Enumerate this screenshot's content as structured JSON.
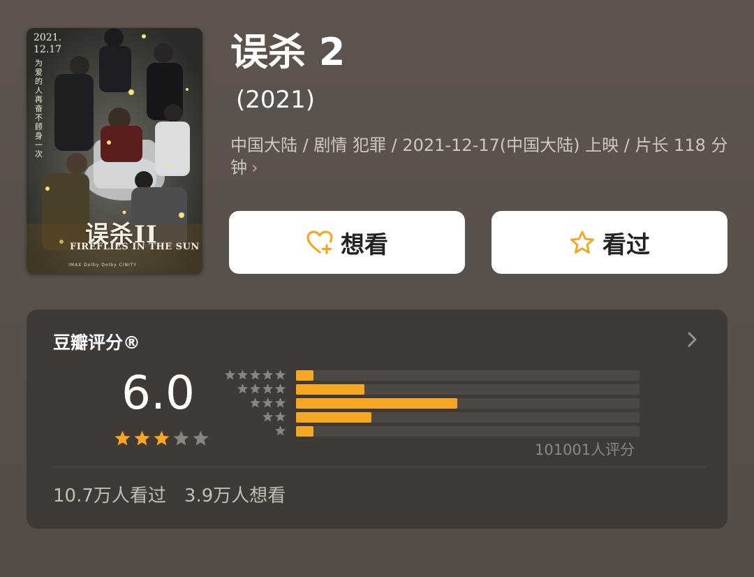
{
  "poster": {
    "date_line1": "2021.",
    "date_line2": "12.17",
    "tagline": "为爱的人 再奋不顾身一次",
    "cn_title": "误杀II",
    "en_title": "FIREFLIES IN THE SUN",
    "footer": "IMAX  Dolby  Dolby  CINITY"
  },
  "movie": {
    "title": "误杀 2",
    "year": "(2021)",
    "meta": "中国大陆 / 剧情 犯罪 / 2021-12-17(中国大陆) 上映 / 片长 118 分钟",
    "meta_chevron": "›"
  },
  "actions": {
    "want_label": "想看",
    "seen_label": "看过",
    "accent": "#f5a623"
  },
  "rating": {
    "title": "豆瓣评分®",
    "score": "6.0",
    "score_stars": 3,
    "votes_text": "101001人评分",
    "distribution": [
      {
        "stars": 5,
        "fraction": 0.05
      },
      {
        "stars": 4,
        "fraction": 0.2
      },
      {
        "stars": 3,
        "fraction": 0.47
      },
      {
        "stars": 2,
        "fraction": 0.22
      },
      {
        "stars": 1,
        "fraction": 0.05
      }
    ],
    "seen_count": "10.7万人看过",
    "want_count": "3.9万人想看"
  },
  "colors": {
    "star_on": "#f5a623",
    "star_off": "#8a847e",
    "dist_star": "#8a847e"
  }
}
